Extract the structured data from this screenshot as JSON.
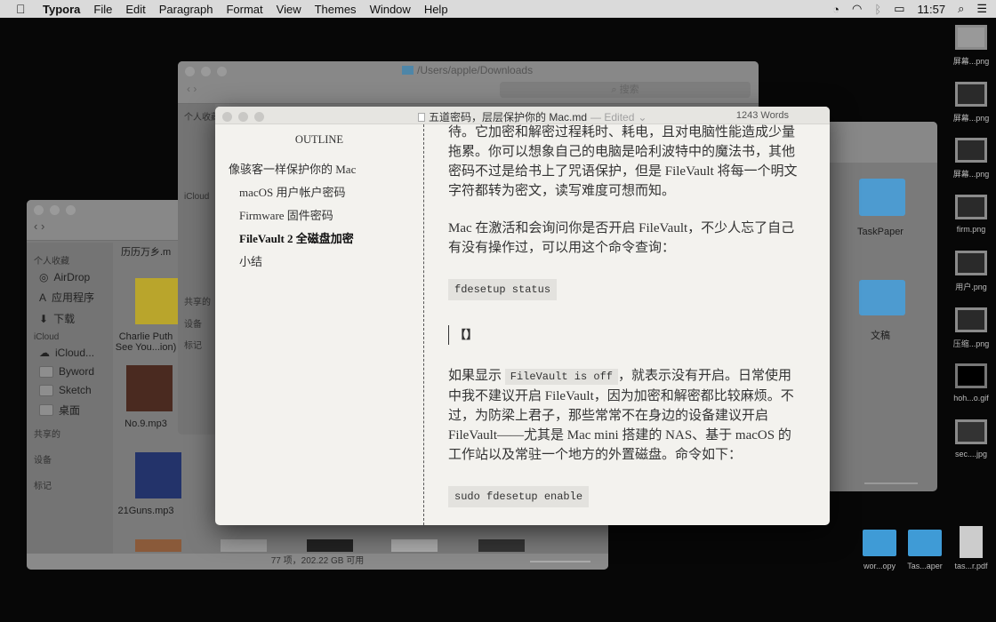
{
  "menubar": {
    "app": "Typora",
    "items": [
      "File",
      "Edit",
      "Paragraph",
      "Format",
      "View",
      "Themes",
      "Window",
      "Help"
    ],
    "clock": "11:57"
  },
  "finder_back": {
    "path": "/Users/apple/Downloads",
    "search_placeholder": "搜索",
    "sidebar": [
      "个人收藏",
      "iCloud",
      "共享的",
      "设备",
      "标记"
    ]
  },
  "finder_front": {
    "sidebar": {
      "favorites_header": "个人收藏",
      "favorites": [
        "AirDrop",
        "应用程序",
        "下载"
      ],
      "icloud_header": "iCloud",
      "icloud": [
        "iCloud...",
        "Byword",
        "Sketch",
        "桌面"
      ],
      "shared": "共享的",
      "devices": "设备",
      "tags": "标记"
    },
    "files": [
      "历历万乡.m",
      "Charlie Puth See You...ion)",
      "No.9.mp3",
      "21Guns.mp3"
    ],
    "status": "77 项，202.22 GB 可用"
  },
  "finder_right": {
    "items": [
      "TaskPaper",
      "文稿"
    ]
  },
  "typora": {
    "title": "五道密码，层层保护你的 Mac.md",
    "edited": "— Edited",
    "word_count": "1243 Words",
    "outline": {
      "header": "OUTLINE",
      "items": [
        "像骇客一样保护你的 Mac",
        "macOS 用户帐户密码",
        "Firmware 固件密码",
        "FileVault 2 全磁盘加密",
        "小结"
      ]
    },
    "content": {
      "p1": "待。它加密和解密过程耗时、耗电，且对电脑性能造成少量拖累。你可以想象自己的电脑是哈利波特中的魔法书，其他密码不过是给书上了咒语保护，但是 FileVault 将每一个明文字符都转为密文，读写难度可想而知。",
      "p2": "Mac 在激活和会询问你是否开启 FileVault，不少人忘了自己有没有操作过，可以用这个命令查询：",
      "code1": "fdesetup status",
      "bracket": "【】",
      "p3a": "如果显示 ",
      "p3code": "FileVault is off",
      "p3b": "，就表示没有开启。日常使用中我不建议开启 FileVault，因为加密和解密都比较麻烦。不过，为防梁上君子，那些常常不在身边的设备建议开启 FileVault——尤其是 Mac mini 搭建的 NAS、基于 macOS 的工作站以及常驻一个地方的外置磁盘。命令如下：",
      "code2": "sudo fdesetup enable"
    }
  },
  "desktop": {
    "right_column": [
      "屏幕...png",
      "屏幕...png",
      "屏幕...png",
      "firm.png",
      "用户.png",
      "压缩...png",
      "hoh...o.gif",
      "sec....jpg"
    ],
    "bottom": [
      "wor...opy",
      "Tas...aper",
      "tas...r.pdf"
    ]
  }
}
